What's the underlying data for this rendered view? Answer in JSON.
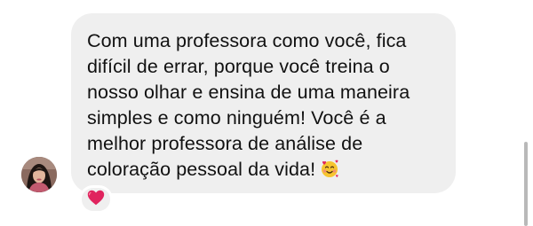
{
  "message": {
    "lines": [
      "Com uma professora como você, fica",
      "difícil de errar, porque você treina o",
      "nosso olhar e ensina de uma maneira",
      "simples e como ninguém! Você é a",
      "melhor professora de análise de",
      "coloração pessoal da vida!"
    ],
    "trailing_emoji": "smiling-face-with-hearts"
  },
  "reaction": {
    "emoji": "red-heart"
  },
  "colors": {
    "bubble_background": "#efefef",
    "text": "#111111",
    "heart": "#e0245e",
    "emoji_face": "#f7c52f",
    "scrollbar": "#b9b9b9"
  }
}
